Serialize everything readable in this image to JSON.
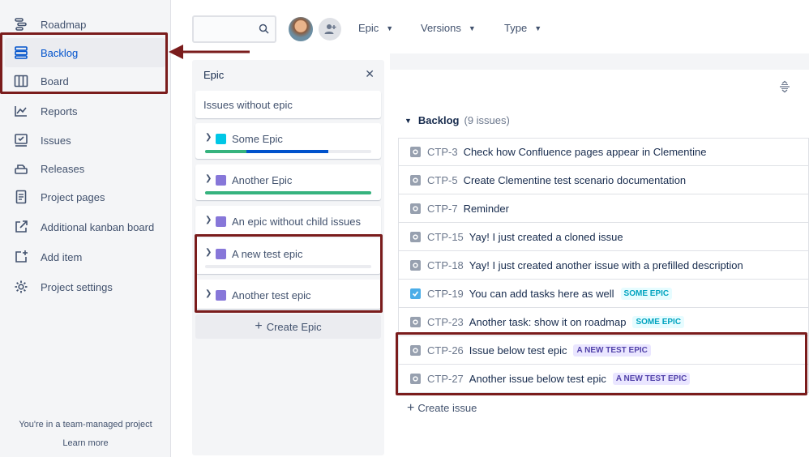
{
  "sidebar": {
    "items": [
      {
        "label": "Roadmap",
        "icon": "roadmap-icon",
        "active": false
      },
      {
        "label": "Backlog",
        "icon": "backlog-icon",
        "active": true
      },
      {
        "label": "Board",
        "icon": "board-icon",
        "active": false
      },
      {
        "label": "Reports",
        "icon": "reports-icon",
        "active": false
      },
      {
        "label": "Issues",
        "icon": "issues-icon",
        "active": false
      },
      {
        "label": "Releases",
        "icon": "releases-icon",
        "active": false
      },
      {
        "label": "Project pages",
        "icon": "project-pages-icon",
        "active": false
      },
      {
        "label": "Additional kanban board",
        "icon": "external-link-icon",
        "active": false
      },
      {
        "label": "Add item",
        "icon": "add-item-icon",
        "active": false
      },
      {
        "label": "Project settings",
        "icon": "gear-icon",
        "active": false
      }
    ],
    "footer_text": "You're in a team-managed project",
    "learn_more": "Learn more"
  },
  "toolbar": {
    "search_placeholder": "",
    "filters": [
      "Epic",
      "Versions",
      "Type"
    ]
  },
  "epic_panel": {
    "title": "Epic",
    "no_epic_label": "Issues without epic",
    "epics": [
      {
        "name": "Some Epic",
        "color": "#00c7e6",
        "progress_done": 0.25,
        "progress_in_progress": 0.49
      },
      {
        "name": "Another Epic",
        "color": "#8777d9",
        "progress_done": 1.0,
        "progress_in_progress": 0
      },
      {
        "name": "An epic without child issues",
        "color": "#8777d9"
      },
      {
        "name": "A new test epic",
        "color": "#8777d9",
        "progress_done": 0,
        "progress_in_progress": 0
      },
      {
        "name": "Another test epic",
        "color": "#8777d9"
      }
    ],
    "create_label": "Create Epic"
  },
  "backlog": {
    "title": "Backlog",
    "count": "(9 issues)",
    "issues": [
      {
        "key": "CTP-3",
        "summary": "Check how Confluence pages appear in Clementine",
        "type": "story",
        "epic": ""
      },
      {
        "key": "CTP-5",
        "summary": "Create Clementine test scenario documentation",
        "type": "story",
        "epic": ""
      },
      {
        "key": "CTP-7",
        "summary": "Reminder",
        "type": "story",
        "epic": ""
      },
      {
        "key": "CTP-15",
        "summary": "Yay! I just created a cloned issue",
        "type": "story",
        "epic": ""
      },
      {
        "key": "CTP-18",
        "summary": "Yay! I just created another issue with a prefilled description",
        "type": "story",
        "epic": ""
      },
      {
        "key": "CTP-19",
        "summary": "You can add tasks here as well",
        "type": "task",
        "epic": "SOME EPIC"
      },
      {
        "key": "CTP-23",
        "summary": "Another task: show it on roadmap",
        "type": "story",
        "epic": "SOME EPIC"
      },
      {
        "key": "CTP-26",
        "summary": "Issue below test epic",
        "type": "story",
        "epic": "A NEW TEST EPIC"
      },
      {
        "key": "CTP-27",
        "summary": "Another issue below test epic",
        "type": "story",
        "epic": "A NEW TEST EPIC"
      }
    ],
    "create_label": "Create issue"
  },
  "colors": {
    "highlight": "#7a1c1c",
    "some_epic_lozenge_bg": "#e6fcff",
    "some_epic_lozenge_fg": "#00a3bf",
    "new_test_epic_lozenge_bg": "#eae6ff",
    "new_test_epic_lozenge_fg": "#5243aa"
  }
}
